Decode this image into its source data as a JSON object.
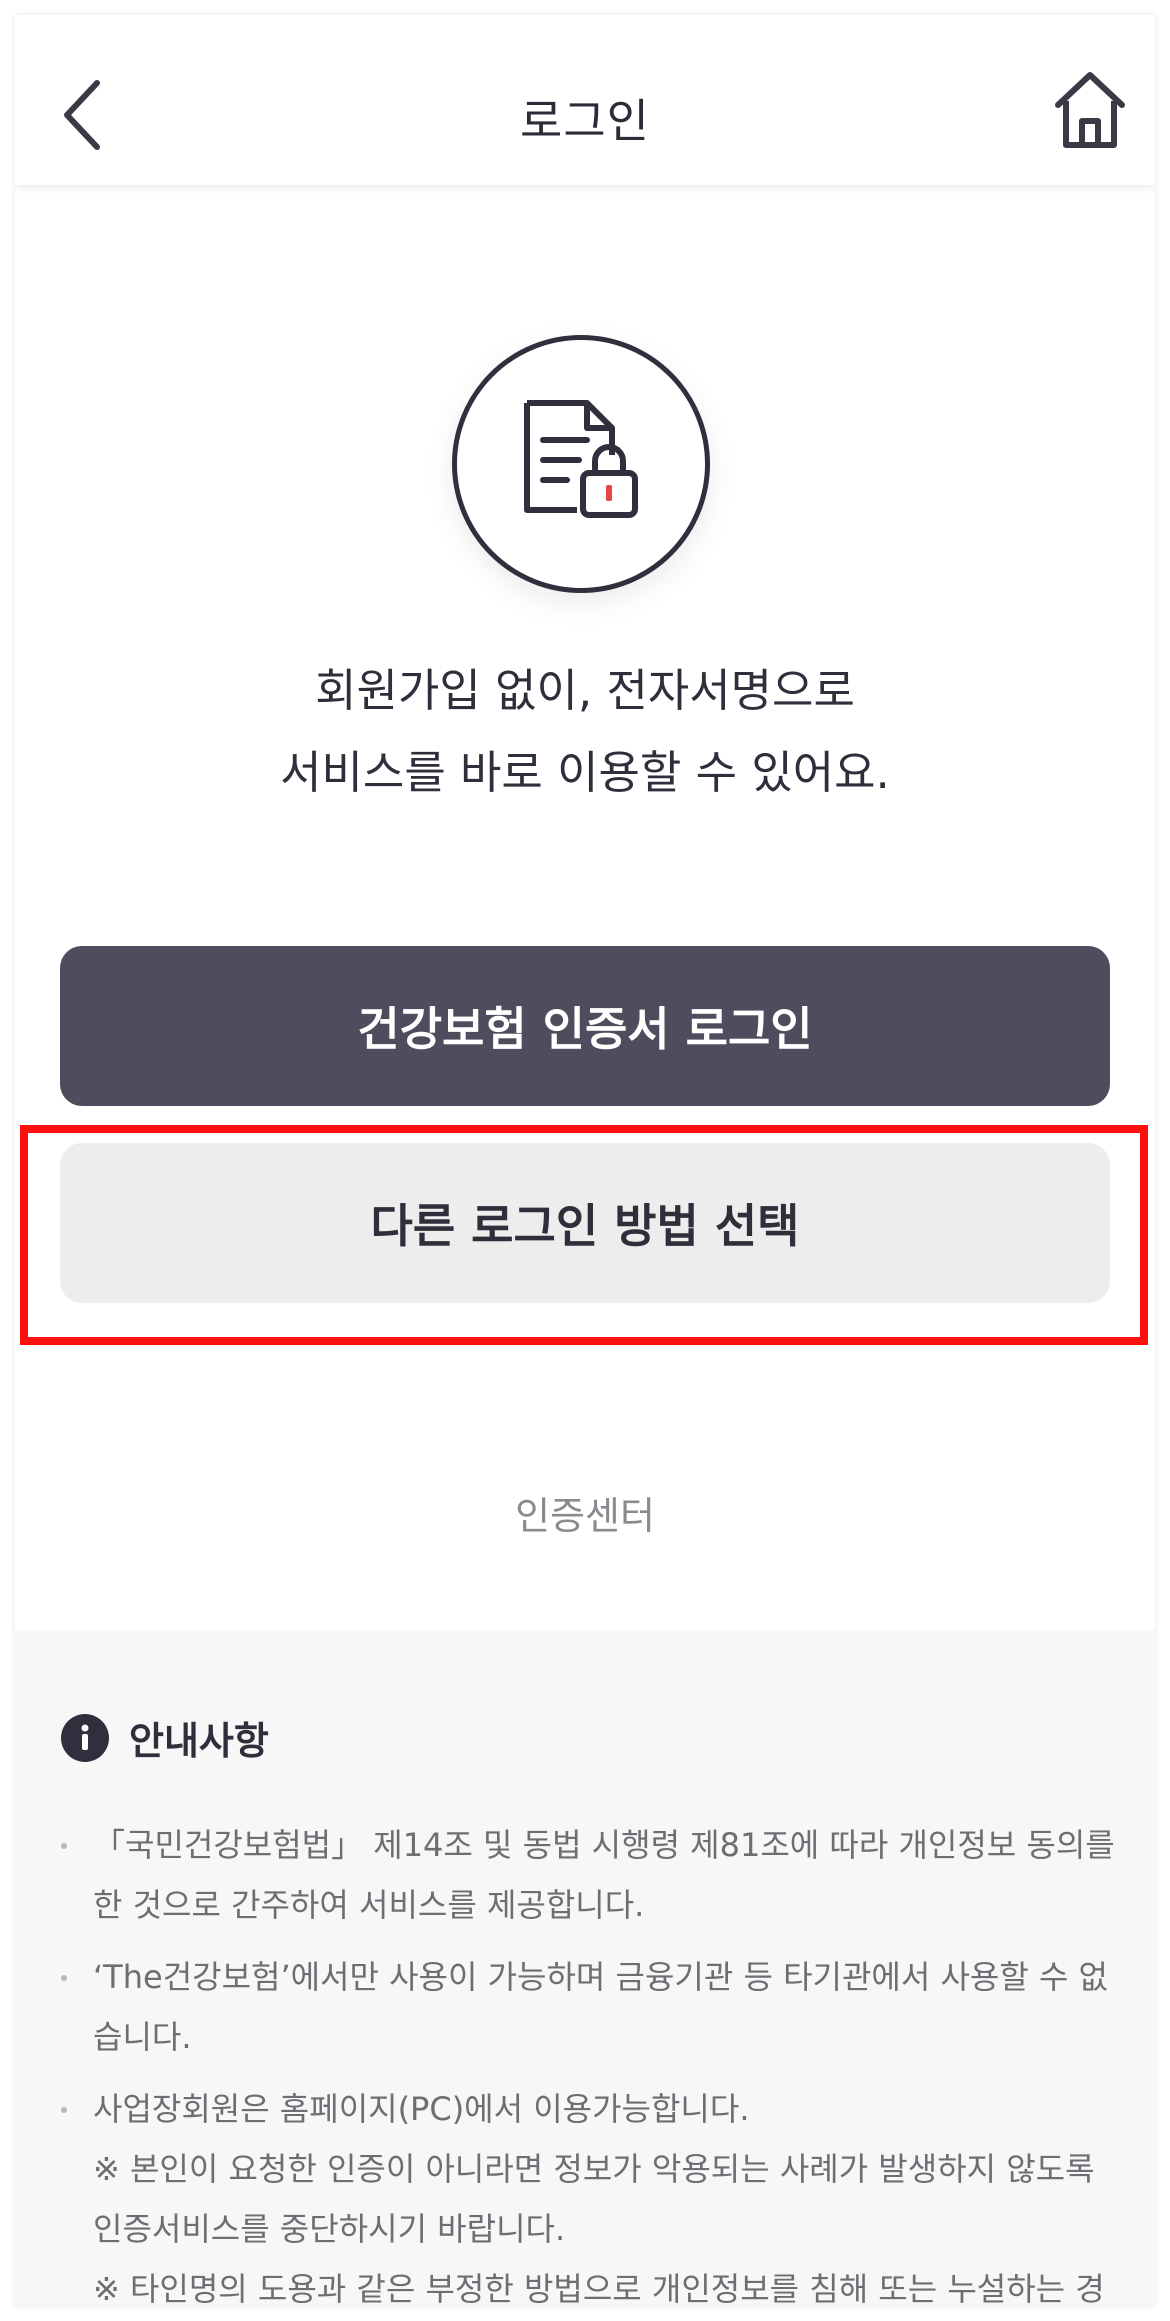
{
  "header": {
    "title": "로그인"
  },
  "hero": {
    "line1": "회원가입 없이, 전자서명으로",
    "line2": "서비스를 바로 이용할 수 있어요."
  },
  "buttons": {
    "primary": "건강보험 인증서 로그인",
    "secondary": "다른 로그인 방법 선택"
  },
  "links": {
    "auth_center": "인증센터"
  },
  "notice": {
    "title": "안내사항",
    "items": [
      {
        "text": "「국민건강보험법」 제14조 및 동법 시행령 제81조에 따라 개인정보 동의를 한 것으로 간주하여 서비스를 제공합니다."
      },
      {
        "text": "‘The건강보험’에서만 사용이 가능하며 금융기관 등 타기관에서 사용할 수 없습니다."
      },
      {
        "text": "사업장회원은 홈페이지(PC)에서 이용가능합니다.",
        "note1": "※ 본인이 요청한 인증이 아니라면 정보가 악용되는 사례가 발생하지 않도록 인증서비스를 중단하시기 바랍니다.",
        "note2": "※ 타인명의 도용과 같은 부정한 방법으로 개인정보를 침해 또는 누설하는 경"
      }
    ]
  },
  "colors": {
    "primary_button": "#4f4d5d",
    "secondary_button": "#ededed",
    "highlight": "#ff1010",
    "lock_accent": "#e84646"
  }
}
